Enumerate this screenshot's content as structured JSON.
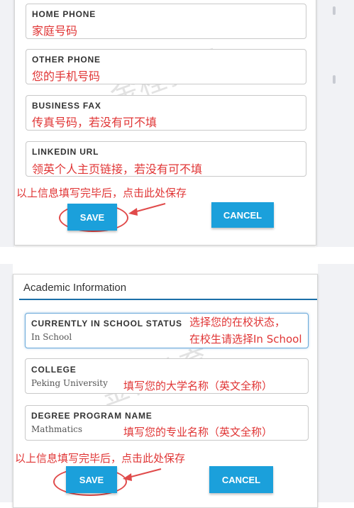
{
  "top": {
    "fields": [
      {
        "label": "HOME PHONE",
        "annotation": "家庭号码"
      },
      {
        "label": "OTHER PHONE",
        "annotation": "您的手机号码"
      },
      {
        "label": "BUSINESS FAX",
        "annotation": "传真号码，若没有可不填"
      },
      {
        "label": "LINKEDIN URL",
        "annotation": "领英个人主页链接，若没有可不填"
      }
    ],
    "instruction": "以上信息填写完毕后，点击此处保存",
    "save_label": "SAVE",
    "cancel_label": "CANCEL",
    "watermark": "金程教育"
  },
  "bottom": {
    "section_title": "Academic Information",
    "fields": [
      {
        "label": "CURRENTLY IN SCHOOL STATUS",
        "value": "In School"
      },
      {
        "label": "COLLEGE",
        "value": "Peking University",
        "annotation": "填写您的大学名称（英文全称）"
      },
      {
        "label": "DEGREE PROGRAM NAME",
        "value": "Mathmatics",
        "annotation": "填写您的专业名称（英文全称）"
      }
    ],
    "status_annotation_line1": "选择您的在校状态，",
    "status_annotation_line2": "在校生请选择In School",
    "instruction": "以上信息填写完毕后，点击此处保存",
    "save_label": "SAVE",
    "cancel_label": "CANCEL",
    "watermark": "金程教育"
  },
  "colors": {
    "accent": "#1ba0db",
    "annotation": "#e03535"
  }
}
